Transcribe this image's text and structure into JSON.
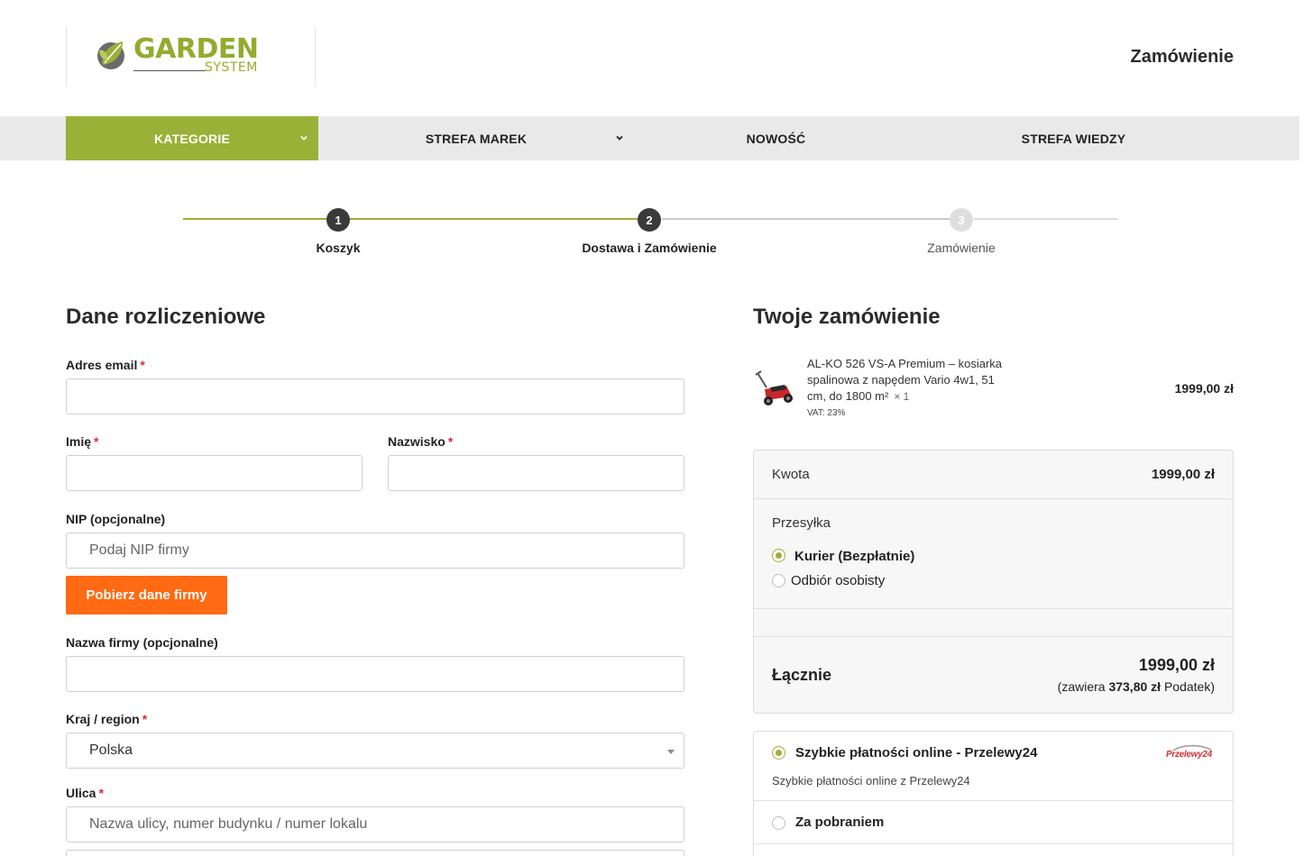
{
  "header": {
    "logo_word": "GARDEN",
    "logo_sub": "SYSTEM",
    "title": "Zamówienie"
  },
  "nav": {
    "items": [
      {
        "label": "KATEGORIE"
      },
      {
        "label": "STREFA MAREK"
      },
      {
        "label": "NOWOŚĆ"
      },
      {
        "label": "STREFA WIEDZY"
      }
    ]
  },
  "steps": [
    {
      "number": "1",
      "label": "Koszyk",
      "state": "done"
    },
    {
      "number": "2",
      "label": "Dostawa i Zamówienie",
      "state": "current"
    },
    {
      "number": "3",
      "label": "Zamówienie",
      "state": "pending"
    }
  ],
  "billing": {
    "title": "Dane rozliczeniowe",
    "required_mark": "*",
    "email_label": "Adres email",
    "first_name_label": "Imię",
    "last_name_label": "Nazwisko",
    "nip_label": "NIP (opcjonalne)",
    "nip_placeholder": "Podaj NIP firmy",
    "nip_button": "Pobierz dane firmy",
    "company_label": "Nazwa firmy (opcjonalne)",
    "country_label": "Kraj / region",
    "country_value": "Polska",
    "street_label": "Ulica",
    "street_placeholder": "Nazwa ulicy, numer budynku / numer lokalu"
  },
  "order": {
    "title": "Twoje zamówienie",
    "product": {
      "name": "AL-KO 526 VS-A Premium – kosiarka spalinowa z napędem Vario 4w1, 51 cm, do 1800 m²",
      "qty": "× 1",
      "vat": "VAT: 23%",
      "price": "1999,00 zł"
    },
    "summary": {
      "amount_label": "Kwota",
      "amount_value": "1999,00 zł",
      "shipping_label": "Przesyłka",
      "shipping_options": [
        {
          "label": "Kurier (Bezpłatnie)",
          "selected": true
        },
        {
          "label": "Odbiór osobisty",
          "selected": false
        }
      ],
      "total_label": "Łącznie",
      "total_value": "1999,00 zł",
      "tax_prefix": "(zawiera",
      "tax_value": "373,80 zł",
      "tax_suffix": "Podatek)"
    },
    "payment": {
      "options": [
        {
          "label": "Szybkie płatności online - Przelewy24",
          "description": "Szybkie płatności online z Przelewy24",
          "selected": true,
          "logo_text": "Przelewy24"
        },
        {
          "label": "Za pobraniem",
          "selected": false
        }
      ]
    }
  },
  "colors": {
    "brand_green": "#9bb037",
    "button_orange": "#ff6a13",
    "step_dark": "#3a3a3a",
    "step_pending": "#d9d9d9"
  }
}
